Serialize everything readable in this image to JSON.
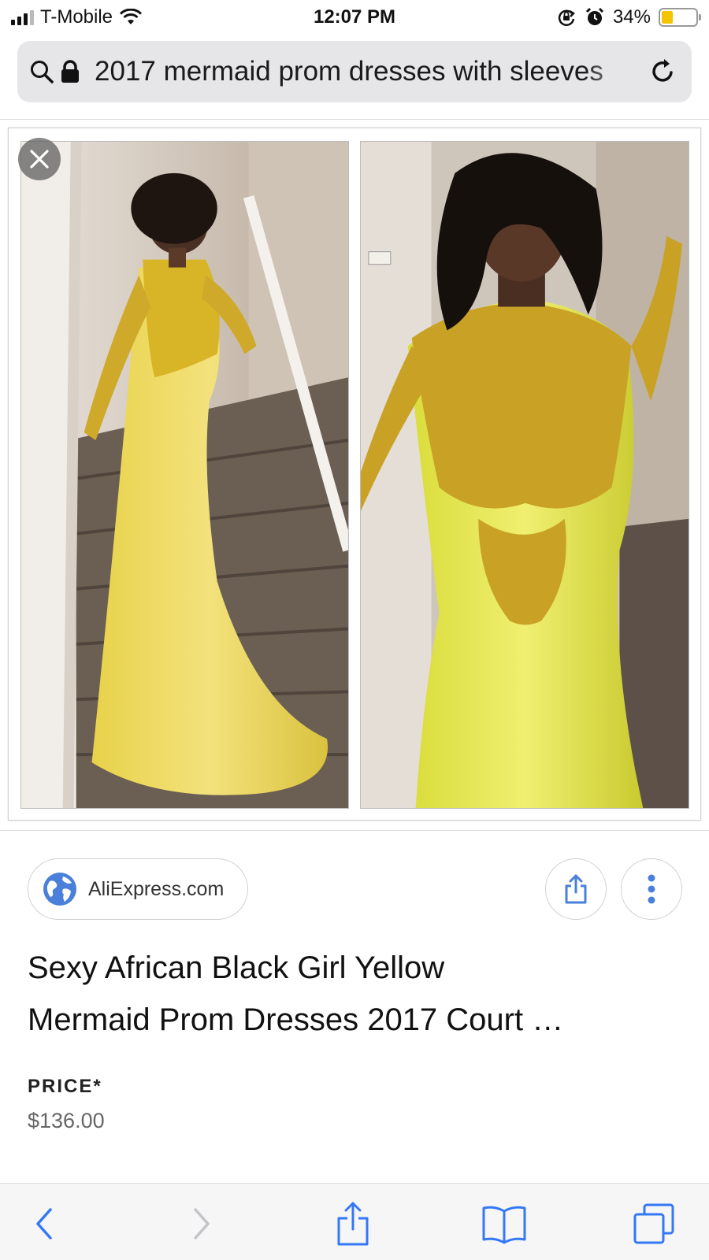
{
  "status_bar": {
    "carrier": "T-Mobile",
    "time": "12:07 PM",
    "battery": "34%",
    "battery_level": 0.34,
    "battery_color": "#f5c400"
  },
  "url_bar": {
    "query": "2017 mermaid prom dresses with sleeves",
    "icons": [
      "search-icon",
      "lock-icon",
      "reload-icon"
    ]
  },
  "viewer": {
    "images": [
      "dress-photo-full-length",
      "dress-photo-closeup"
    ],
    "close_icon": "close-icon"
  },
  "result": {
    "source": "AliExpress.com",
    "title_line1": "Sexy African Black Girl Yellow",
    "title_line2": "Mermaid Prom Dresses 2017 Court …",
    "price_label": "PRICE*",
    "price_value": "$136.00",
    "accent_color": "#4a80d9"
  },
  "toolbar": {
    "buttons": [
      "back-icon",
      "forward-icon",
      "share-icon",
      "bookmarks-icon",
      "tabs-icon"
    ]
  }
}
